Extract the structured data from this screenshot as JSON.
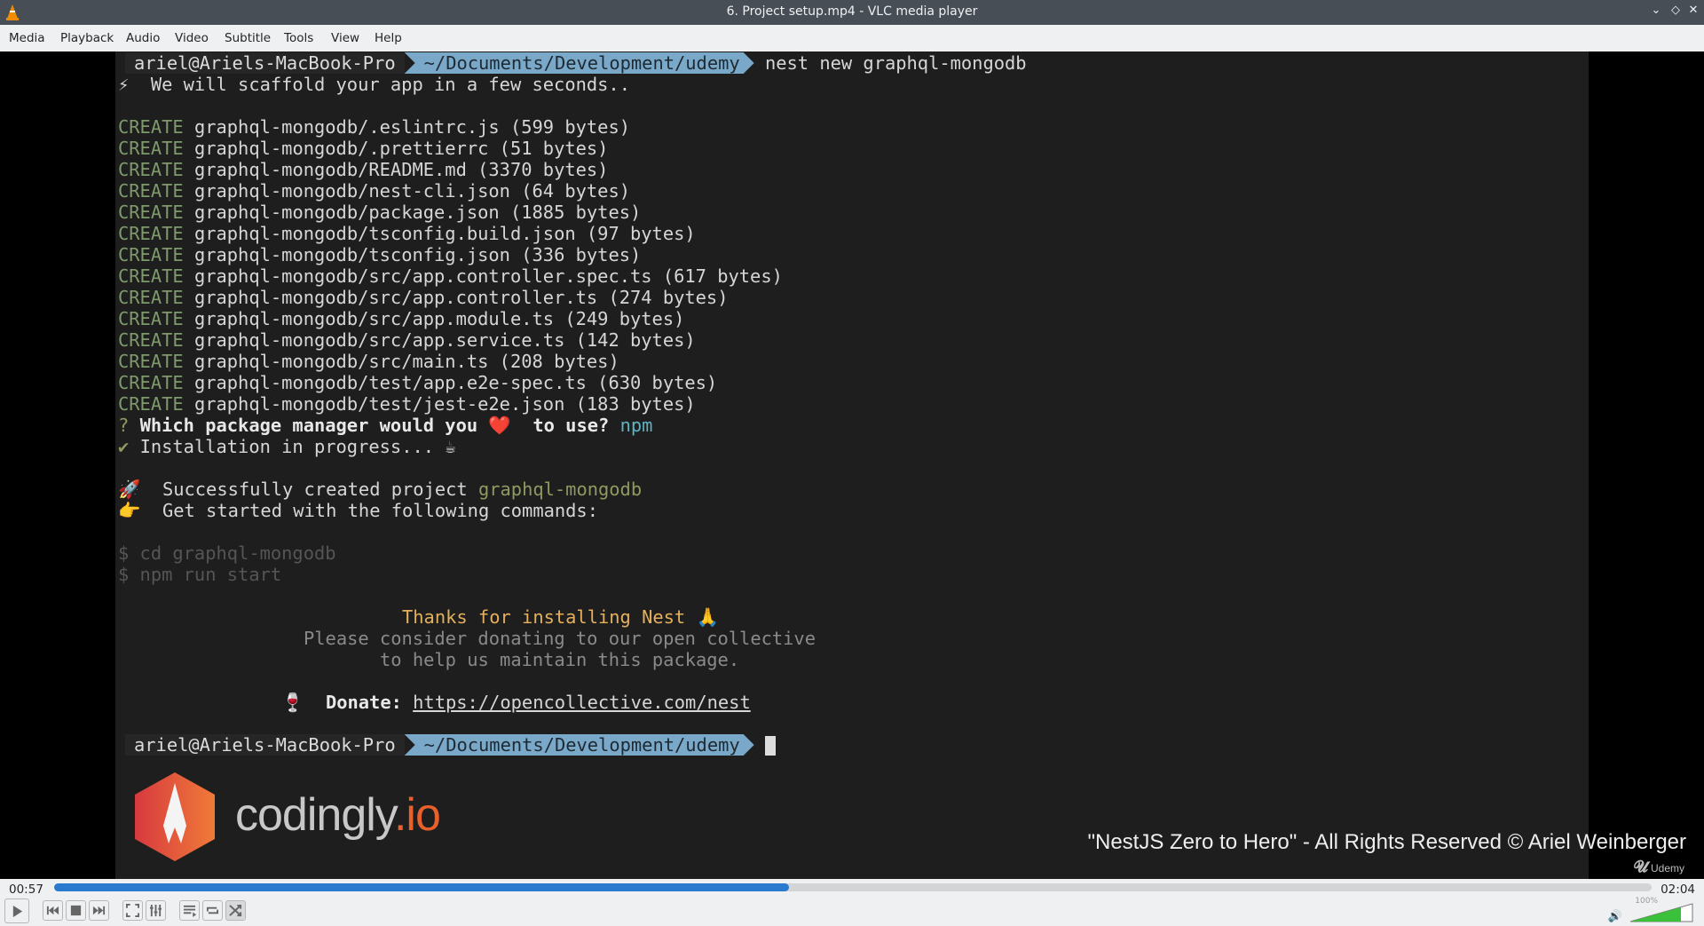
{
  "window": {
    "title": "6. Project setup.mp4 - VLC media player"
  },
  "menu": [
    "Media",
    "Playback",
    "Audio",
    "Video",
    "Subtitle",
    "Tools",
    "View",
    "Help"
  ],
  "terminal": {
    "prompt_user": "ariel@Ariels-MacBook-Pro",
    "prompt_path": "~/Documents/Development/udemy",
    "command": "nest new graphql-mongodb",
    "scaffold": "⚡  We will scaffold your app in a few seconds..",
    "create_label": "CREATE",
    "creates": [
      "graphql-mongodb/.eslintrc.js (599 bytes)",
      "graphql-mongodb/.prettierrc (51 bytes)",
      "graphql-mongodb/README.md (3370 bytes)",
      "graphql-mongodb/nest-cli.json (64 bytes)",
      "graphql-mongodb/package.json (1885 bytes)",
      "graphql-mongodb/tsconfig.build.json (97 bytes)",
      "graphql-mongodb/tsconfig.json (336 bytes)",
      "graphql-mongodb/src/app.controller.spec.ts (617 bytes)",
      "graphql-mongodb/src/app.controller.ts (274 bytes)",
      "graphql-mongodb/src/app.module.ts (249 bytes)",
      "graphql-mongodb/src/app.service.ts (142 bytes)",
      "graphql-mongodb/src/main.ts (208 bytes)",
      "graphql-mongodb/test/app.e2e-spec.ts (630 bytes)",
      "graphql-mongodb/test/jest-e2e.json (183 bytes)"
    ],
    "question_mark": "?",
    "question": "Which package manager would you ❤️  to use?",
    "answer": "npm",
    "check": "✔",
    "installing": "Installation in progress... ☕",
    "success_prefix": "🚀  Successfully created project",
    "project": "graphql-mongodb",
    "get_started": "👉  Get started with the following commands:",
    "cmd1": "$ cd graphql-mongodb",
    "cmd2": "$ npm run start",
    "thanks": "Thanks for installing Nest 🙏",
    "please1": "Please consider donating to our open collective",
    "please2": "to help us maintain this package.",
    "donate_label": "🍷  Donate:",
    "donate_url": "https://opencollective.com/nest"
  },
  "watermark": {
    "brand": "codingly",
    "brand_tld": ".io",
    "copyright": "\"NestJS Zero to Hero\" - All Rights Reserved © Ariel Weinberger",
    "udemy": "Udemy"
  },
  "player": {
    "elapsed": "00:57",
    "total": "02:04",
    "progress_percent": 46,
    "volume_label": "100%",
    "volume_percent": 100
  }
}
